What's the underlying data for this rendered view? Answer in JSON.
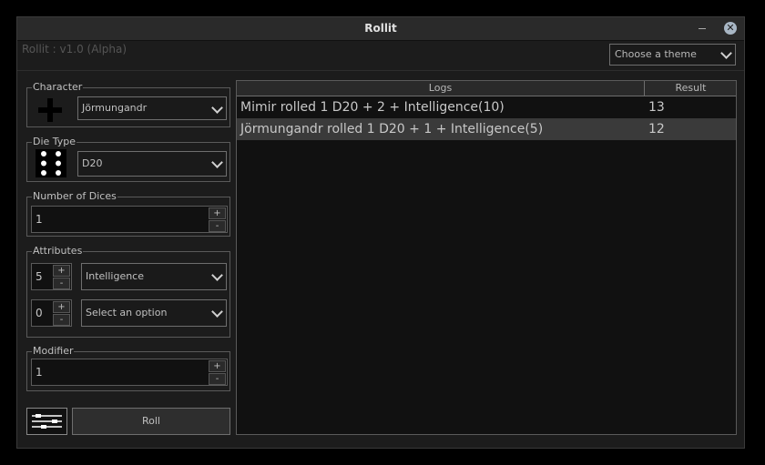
{
  "window": {
    "title": "Rollit",
    "version": "Rollit : v1.0 (Alpha)"
  },
  "theme": {
    "placeholder": "Choose a theme"
  },
  "character": {
    "label": "Character",
    "selected": "Jörmungandr"
  },
  "die_type": {
    "label": "Die Type",
    "selected": "D20"
  },
  "dice_count": {
    "label": "Number of Dices",
    "value": "1"
  },
  "attributes": {
    "label": "Attributes",
    "rows": [
      {
        "value": "5",
        "selected": "Intelligence"
      },
      {
        "value": "0",
        "selected": "Select an option"
      }
    ]
  },
  "modifier": {
    "label": "Modifier",
    "value": "1"
  },
  "spin": {
    "up": "+",
    "down": "-"
  },
  "roll_label": "Roll",
  "logs": {
    "columns": {
      "logs": "Logs",
      "result": "Result"
    },
    "rows": [
      {
        "text": "Mimir rolled 1 D20 + 2 + Intelligence(10)",
        "result": "13"
      },
      {
        "text": "Jörmungandr rolled 1 D20 + 1 + Intelligence(5)",
        "result": "12"
      }
    ]
  }
}
